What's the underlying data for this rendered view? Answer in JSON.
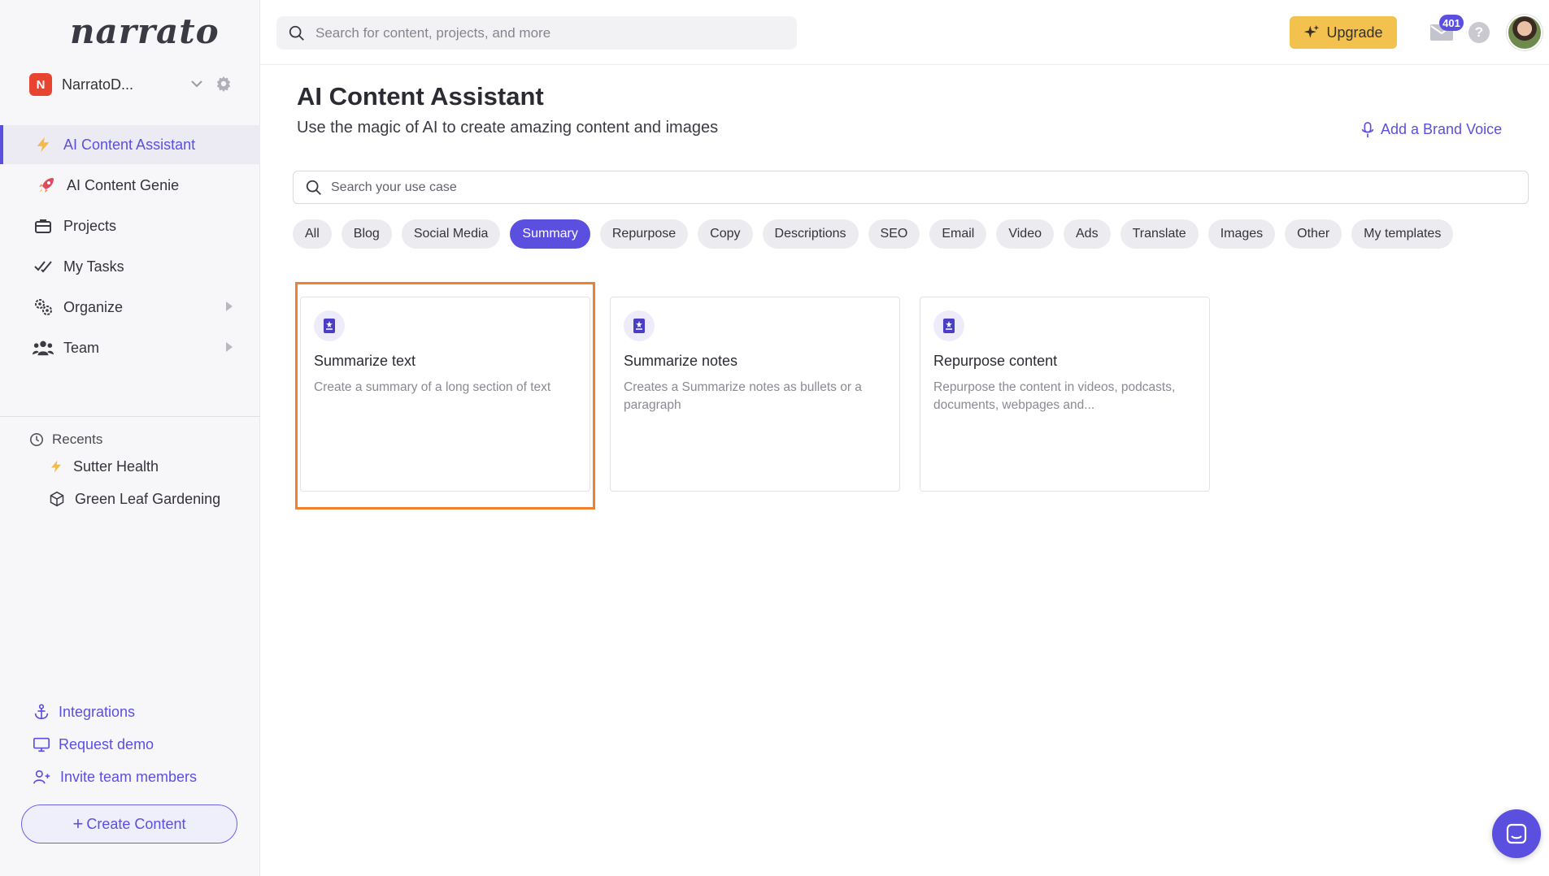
{
  "app": {
    "logo": "narrato"
  },
  "org": {
    "initial": "N",
    "name": "NarratoD..."
  },
  "nav": {
    "items": [
      {
        "label": "AI Content Assistant",
        "icon": "bolt-icon",
        "active": true
      },
      {
        "label": "AI Content Genie",
        "icon": "rocket-icon"
      },
      {
        "label": "Projects",
        "icon": "briefcase-icon"
      },
      {
        "label": "My Tasks",
        "icon": "checkmarks-icon"
      },
      {
        "label": "Organize",
        "icon": "gears-icon"
      },
      {
        "label": "Team",
        "icon": "team-icon"
      }
    ]
  },
  "recents": {
    "heading": "Recents",
    "items": [
      {
        "label": "Sutter Health",
        "icon": "bolt-icon"
      },
      {
        "label": "Green Leaf Gardening",
        "icon": "cube-icon"
      }
    ]
  },
  "sidebar_links": {
    "integrations": "Integrations",
    "request_demo": "Request demo",
    "invite": "Invite team members"
  },
  "create_button": {
    "plus": "+",
    "label": "Create Content"
  },
  "topbar": {
    "search_placeholder": "Search for content, projects, and more",
    "upgrade_label": "Upgrade",
    "mail_count": "401",
    "help_label": "?"
  },
  "page": {
    "title": "AI Content Assistant",
    "subtitle": "Use the magic of AI to create amazing content and images",
    "brand_voice": "Add a Brand Voice",
    "usecase_placeholder": "Search your use case"
  },
  "chips": [
    {
      "label": "All"
    },
    {
      "label": "Blog"
    },
    {
      "label": "Social Media"
    },
    {
      "label": "Summary",
      "active": true
    },
    {
      "label": "Repurpose"
    },
    {
      "label": "Copy"
    },
    {
      "label": "Descriptions"
    },
    {
      "label": "SEO"
    },
    {
      "label": "Email"
    },
    {
      "label": "Video"
    },
    {
      "label": "Ads"
    },
    {
      "label": "Translate"
    },
    {
      "label": "Images"
    },
    {
      "label": "Other"
    },
    {
      "label": "My templates"
    }
  ],
  "cards": [
    {
      "title": "Summarize text",
      "description": "Create a summary of a long section of text"
    },
    {
      "title": "Summarize notes",
      "description": "Creates a Summarize notes as bullets or a paragraph"
    },
    {
      "title": "Repurpose content",
      "description": "Repurpose the content in videos, podcasts, documents, webpages and..."
    }
  ],
  "colors": {
    "accent": "#5b4fe0",
    "upgrade": "#f2c14e",
    "highlight": "#f0802e",
    "org_badge": "#e8432e"
  }
}
